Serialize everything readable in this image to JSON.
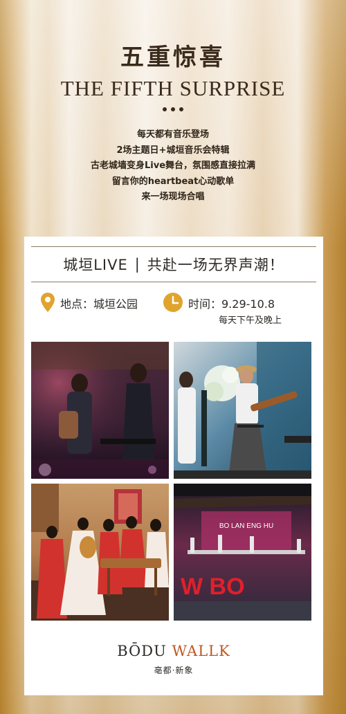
{
  "hero": {
    "title": "五重惊喜",
    "subtitle": "THE FIFTH SURPRISE",
    "lines": [
      "每天都有音乐登场",
      "2场主题日+城垣音乐会特辑",
      "古老城墙变身Live舞台，氛围感直接拉满",
      "留言你的heartbeat心动歌单",
      "来一场现场合唱"
    ]
  },
  "card": {
    "header_left": "城垣LIVE",
    "header_sep": "|",
    "header_right": "共赴一场无界声潮！",
    "location": "地点：城垣公园",
    "time": "时间：9.29-10.8",
    "time_note": "每天下午及晚上",
    "photo3_banner": "BO LAN ENG HU",
    "photo4_text": "W BO"
  },
  "brand": {
    "name_part1": "BŌDU",
    "name_part2": "WALLK",
    "subname": "亳都·新象",
    "accent_color": "#c0561f",
    "icon_color": "#e0a42e"
  }
}
